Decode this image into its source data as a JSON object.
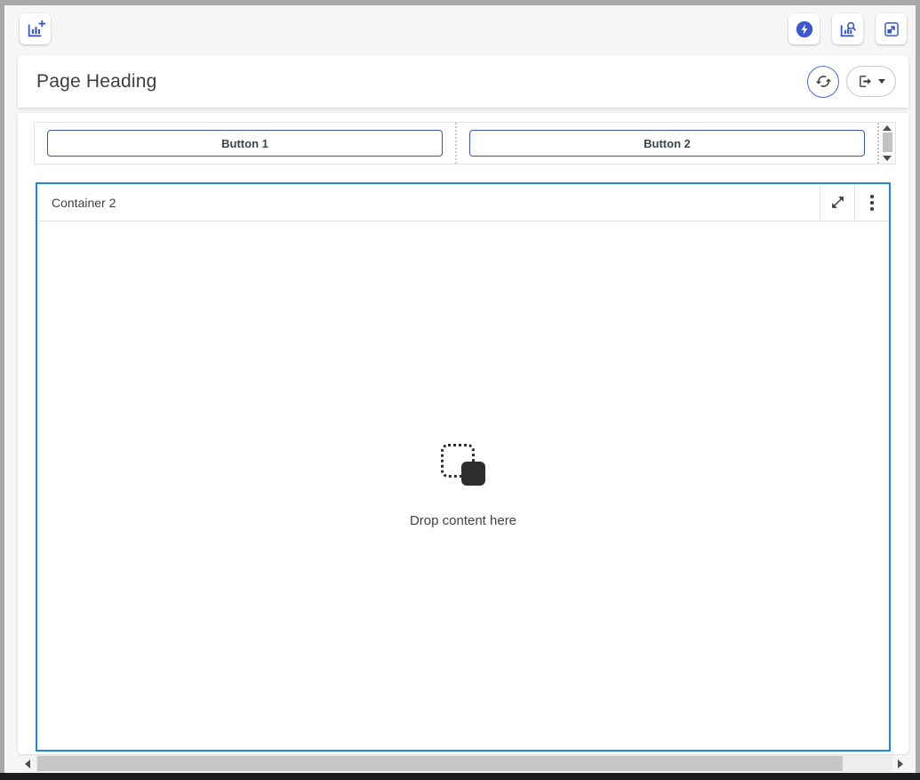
{
  "colors": {
    "accent_blue": "#3b57d1",
    "container_border": "#1e88e5",
    "button_border": "#3f51b5",
    "button_text": "#37474f",
    "text_dark": "#424242",
    "frame_gray": "#a8a8a8"
  },
  "toolbar": {
    "icons": {
      "add_chart": "add-chart-icon",
      "flash": "flash-circle-icon",
      "chart_search": "chart-search-icon",
      "expand": "expand-icon"
    }
  },
  "page_header": {
    "title": "Page Heading",
    "icons": {
      "refresh": "refresh-icon",
      "export": "export-icon",
      "caret": "caret-down-icon"
    }
  },
  "button_row": {
    "buttons": [
      {
        "label": "Button 1"
      },
      {
        "label": "Button 2"
      }
    ]
  },
  "container": {
    "title": "Container 2",
    "drop_text": "Drop content here",
    "icons": {
      "resize": "resize-diagonal-icon",
      "menu": "kebab-menu-icon"
    }
  }
}
